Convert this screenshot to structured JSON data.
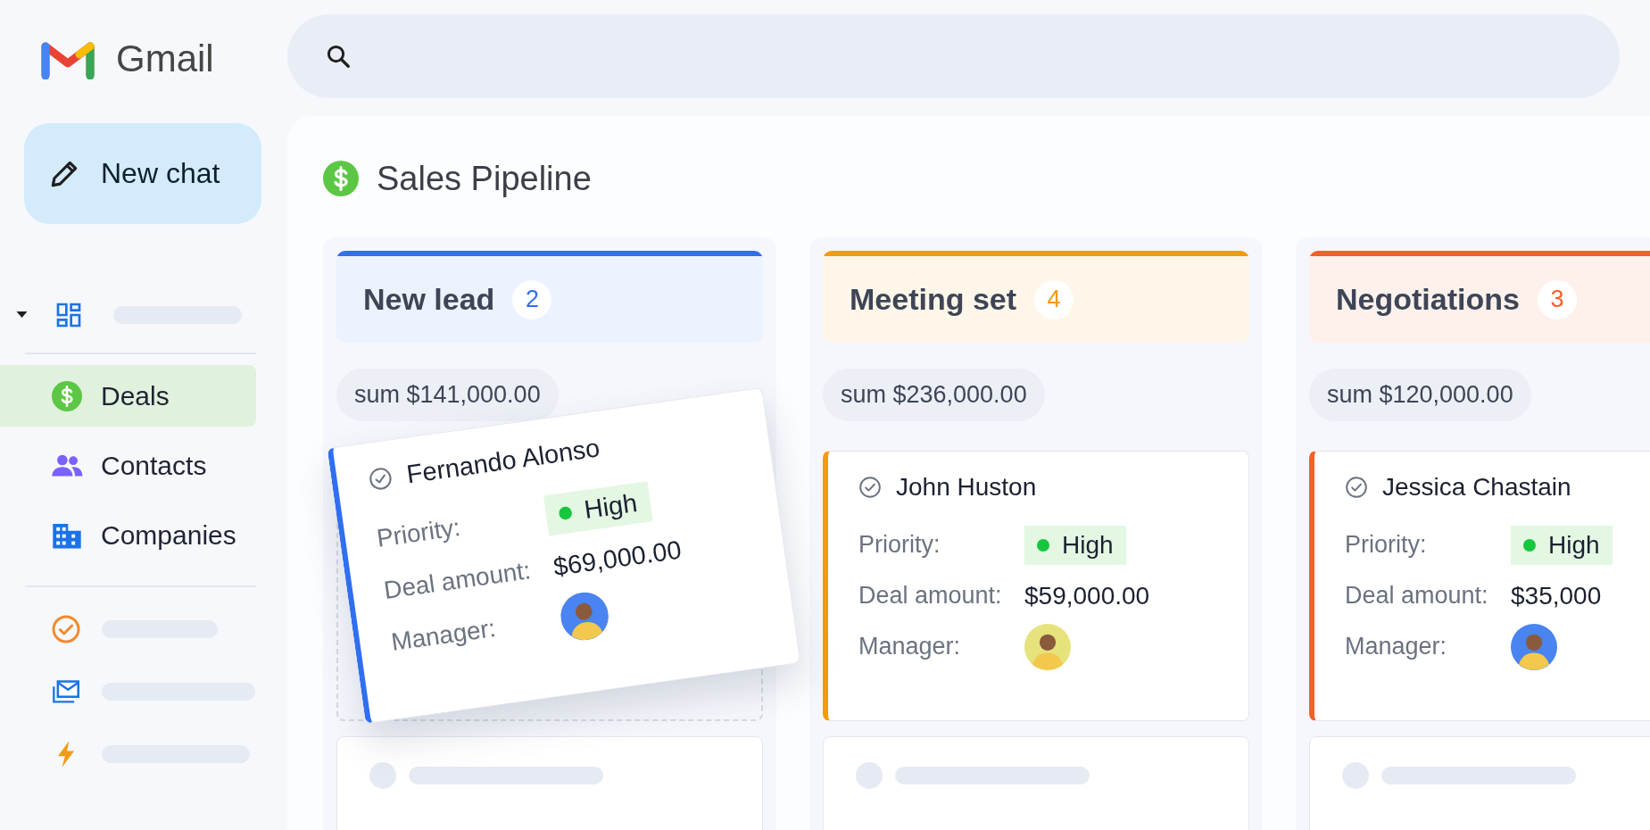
{
  "app": {
    "name": "Gmail"
  },
  "sidebar": {
    "new_chat": "New chat",
    "groups": [
      [
        {
          "kind": "folder",
          "expanded": true
        }
      ],
      [
        {
          "kind": "link",
          "label": "Deals",
          "selected": true
        },
        {
          "kind": "link",
          "label": "Contacts",
          "selected": false
        },
        {
          "kind": "link",
          "label": "Companies",
          "selected": false
        }
      ],
      [
        {
          "kind": "placeholder"
        },
        {
          "kind": "placeholder"
        },
        {
          "kind": "placeholder"
        }
      ]
    ]
  },
  "board": {
    "title": "Sales Pipeline",
    "columns": [
      {
        "title": "New lead",
        "count": "2",
        "color": "#2f6ff0",
        "sum": "sum $141,000.00",
        "cards": [
          {
            "kind": "deal",
            "dragging": true,
            "name": "Fernando Alonso",
            "fields": [
              {
                "kind": "priority",
                "label": "Priority:",
                "value": "High"
              },
              {
                "kind": "text",
                "label": "Deal amount:",
                "value": "$69,000.00"
              },
              {
                "kind": "avatar",
                "label": "Manager:",
                "color": "#4a84f0"
              }
            ]
          },
          {
            "kind": "placeholder"
          }
        ]
      },
      {
        "title": "Meeting set",
        "count": "4",
        "color": "#f59a0c",
        "sum": "sum $236,000.00",
        "cards": [
          {
            "kind": "deal",
            "dragging": false,
            "name": "John Huston",
            "fields": [
              {
                "kind": "priority",
                "label": "Priority:",
                "value": "High"
              },
              {
                "kind": "text",
                "label": "Deal amount:",
                "value": "$59,000.00"
              },
              {
                "kind": "avatar",
                "label": "Manager:",
                "color": "#e6e27c"
              }
            ]
          },
          {
            "kind": "placeholder"
          }
        ]
      },
      {
        "title": "Negotiations",
        "count": "3",
        "color": "#f4602a",
        "sum": "sum $120,000.00",
        "cards": [
          {
            "kind": "deal",
            "dragging": false,
            "name": "Jessica Chastain",
            "fields": [
              {
                "kind": "priority",
                "label": "Priority:",
                "value": "High"
              },
              {
                "kind": "text",
                "label": "Deal amount:",
                "value": "$35,000"
              },
              {
                "kind": "avatar",
                "label": "Manager:",
                "color": "#4a84f0"
              }
            ]
          },
          {
            "kind": "placeholder"
          }
        ]
      }
    ]
  }
}
